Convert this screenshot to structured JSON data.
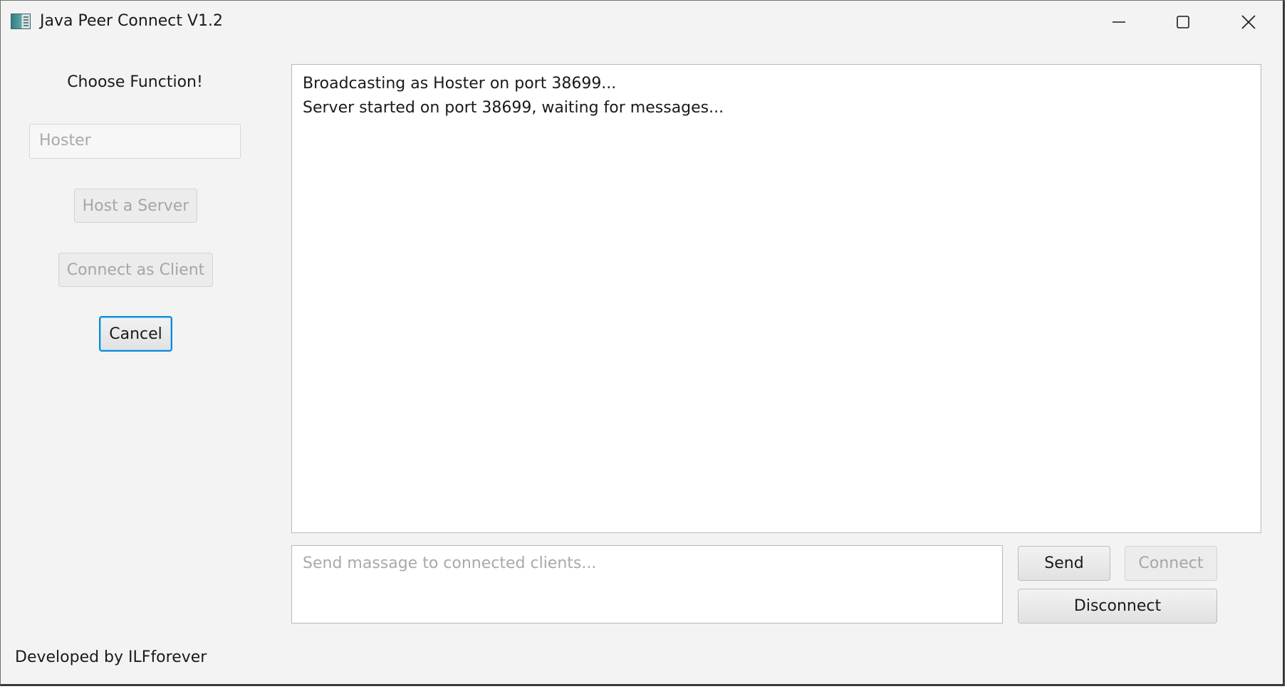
{
  "window": {
    "title": "Java Peer Connect V1.2",
    "icons": {
      "app": "app-icon",
      "minimize": "minimize-icon",
      "maximize": "maximize-icon",
      "close": "close-icon"
    }
  },
  "sidebar": {
    "heading": "Choose Function!",
    "role_field_value": "Hoster",
    "host_label": "Host a Server",
    "client_label": "Connect as Client",
    "cancel_label": "Cancel"
  },
  "log": {
    "lines": [
      "Broadcasting as Hoster on port 38699...",
      "Server started on port 38699, waiting for messages..."
    ]
  },
  "composer": {
    "placeholder": "Send massage to connected clients...",
    "send_label": "Send",
    "connect_label": "Connect",
    "disconnect_label": "Disconnect"
  },
  "footer": {
    "credit": "Developed by ILFforever"
  },
  "colors": {
    "window_bg": "#f3f3f3",
    "focus_accent": "#0a8ad8",
    "disabled_text": "#a6a6a6"
  }
}
